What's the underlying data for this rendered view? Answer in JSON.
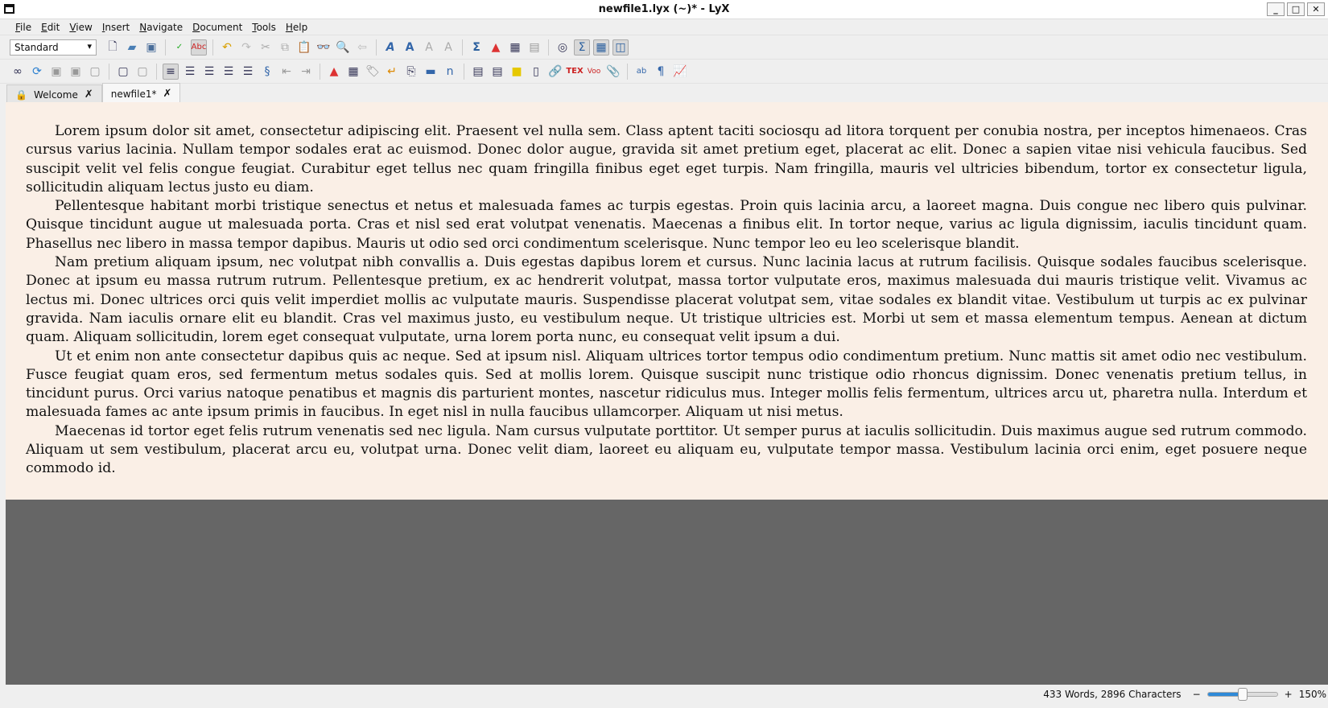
{
  "window": {
    "title": "newfile1.lyx (~)* - LyX"
  },
  "menu": [
    "File",
    "Edit",
    "View",
    "Insert",
    "Navigate",
    "Document",
    "Tools",
    "Help"
  ],
  "toolbar": {
    "layout_combo": "Standard"
  },
  "tabs": [
    {
      "label": "Welcome",
      "active": false
    },
    {
      "label": "newfile1*",
      "active": true
    }
  ],
  "document": {
    "paragraphs": [
      "Lorem ipsum dolor sit amet, consectetur adipiscing elit. Praesent vel nulla sem. Class aptent taciti sociosqu ad litora torquent per conubia nostra, per inceptos himenaeos. Cras cursus varius lacinia. Nullam tempor sodales erat ac euismod. Donec dolor augue, gravida sit amet pretium eget, placerat ac elit. Donec a sapien vitae nisi vehicula faucibus. Sed suscipit velit vel felis congue feugiat. Curabitur eget tellus nec quam fringilla finibus eget eget turpis. Nam fringilla, mauris vel ultricies bibendum, tortor ex consectetur ligula, sollicitudin aliquam lectus justo eu diam.",
      "Pellentesque habitant morbi tristique senectus et netus et malesuada fames ac turpis egestas. Proin quis lacinia arcu, a laoreet magna. Duis congue nec libero quis pulvinar. Quisque tincidunt augue ut malesuada porta. Cras et nisl sed erat volutpat venenatis. Maecenas a finibus elit. In tortor neque, varius ac ligula dignissim, iaculis tincidunt quam. Phasellus nec libero in massa tempor dapibus. Mauris ut odio sed orci condimentum scelerisque. Nunc tempor leo eu leo scelerisque blandit.",
      "Nam pretium aliquam ipsum, nec volutpat nibh convallis a. Duis egestas dapibus lorem et cursus. Nunc lacinia lacus at rutrum facilisis. Quisque sodales faucibus scelerisque. Donec at ipsum eu massa rutrum rutrum. Pellentesque pretium, ex ac hendrerit volutpat, massa tortor vulputate eros, maximus malesuada dui mauris tristique velit. Vivamus ac lectus mi. Donec ultrices orci quis velit imperdiet mollis ac vulputate mauris. Suspendisse placerat volutpat sem, vitae sodales ex blandit vitae. Vestibulum ut turpis ac ex pulvinar gravida. Nam iaculis ornare elit eu blandit. Cras vel maximus justo, eu vestibulum neque. Ut tristique ultricies est. Morbi ut sem et massa elementum tempus. Aenean at dictum quam. Aliquam sollicitudin, lorem eget consequat vulputate, urna lorem porta nunc, eu consequat velit ipsum a dui.",
      "Ut et enim non ante consectetur dapibus quis ac neque. Sed at ipsum nisl. Aliquam ultrices tortor tempus odio condimentum pretium. Nunc mattis sit amet odio nec vestibulum. Fusce feugiat quam eros, sed fermentum metus sodales quis. Sed at mollis lorem. Quisque suscipit nunc tristique odio rhoncus dignissim. Donec venenatis pretium tellus, in tincidunt purus. Orci varius natoque penatibus et magnis dis parturient montes, nascetur ridiculus mus. Integer mollis felis fermentum, ultrices arcu ut, pharetra nulla. Interdum et malesuada fames ac ante ipsum primis in faucibus. In eget nisl in nulla faucibus ullamcorper. Aliquam ut nisi metus.",
      "Maecenas id tortor eget felis rutrum venenatis sed nec ligula. Nam cursus vulputate porttitor. Ut semper purus at iaculis sollicitudin. Duis maximus augue sed rutrum commodo. Aliquam ut sem vestibulum, placerat arcu eu, volutpat urna. Donec velit diam, laoreet eu aliquam eu, vulputate tempor massa. Vestibulum lacinia orci enim, eget posuere neque commodo id."
    ]
  },
  "status": {
    "counts": "433 Words, 2896 Characters",
    "zoom_minus": "−",
    "zoom_plus": "+",
    "zoom": "150%",
    "zoom_slider_fraction": 0.5
  }
}
